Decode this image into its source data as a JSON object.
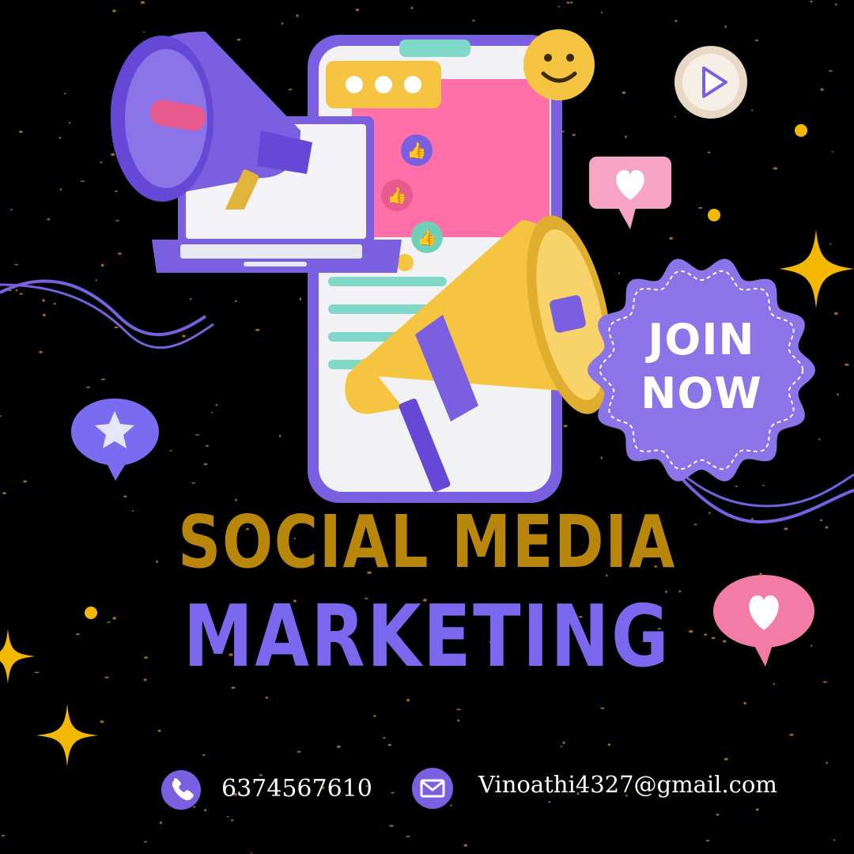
{
  "colors": {
    "background": "#000000",
    "title_gold": "#B8860B",
    "title_purple": "#7B68EE",
    "badge_purple": "#8A74E8",
    "phone_frame": "#7A5FE0",
    "pink": "#FF6FA8",
    "yellow": "#F5C542",
    "teal": "#7FD8C8"
  },
  "badge": {
    "line1": "JOIN",
    "line2": "NOW"
  },
  "title": {
    "line1": "SOCIAL MEDIA",
    "line2": "MARKETING"
  },
  "contact": {
    "phone": "6374567610",
    "email": "Vinoathi4327@gmail.com",
    "phone_icon": "phone-icon",
    "email_icon": "mail-icon"
  },
  "icons": [
    "megaphone-icon",
    "laptop-icon",
    "smartphone-icon",
    "smiley-icon",
    "play-icon",
    "heart-icon",
    "star-icon",
    "thumbs-up-icon",
    "sparkle-icon"
  ]
}
